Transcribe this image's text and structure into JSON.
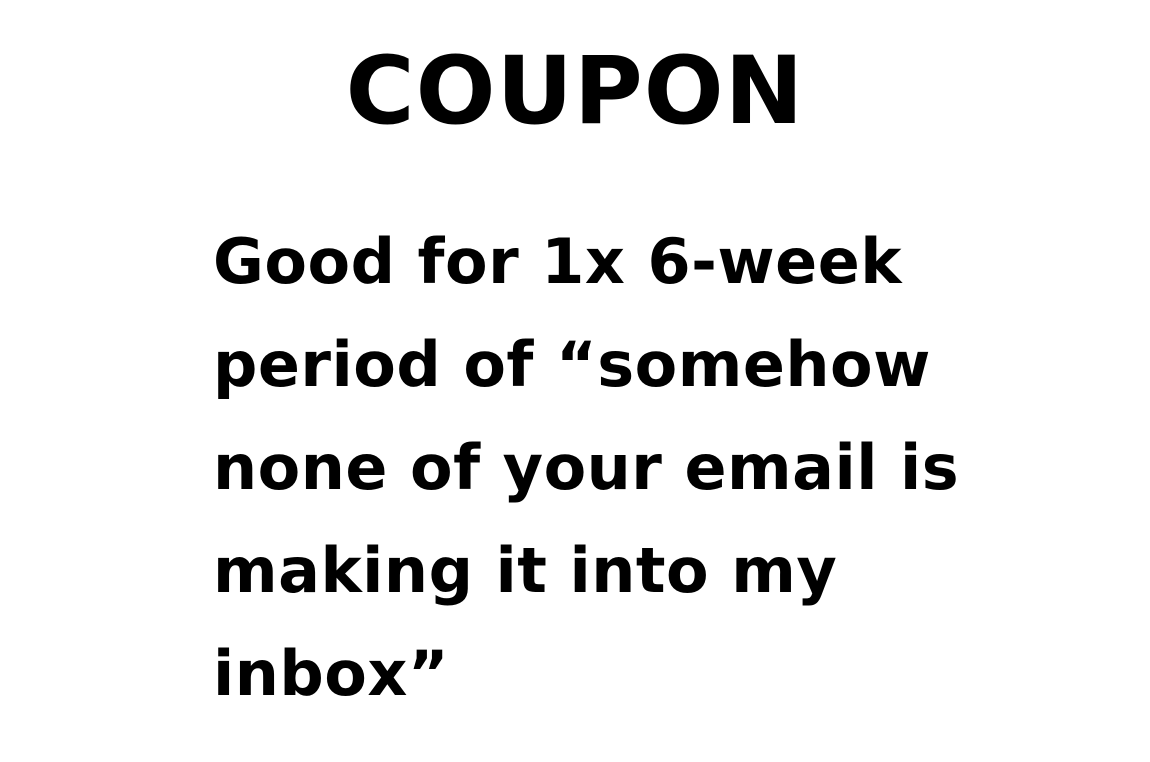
{
  "coupon": {
    "title": "COUPON",
    "body_lines": [
      "Good for 1x 6-week",
      "period of “somehow",
      "none of your email is",
      "making it into my",
      "inbox”"
    ]
  },
  "colors": {
    "background": "#ffffff",
    "text": "#000000"
  }
}
